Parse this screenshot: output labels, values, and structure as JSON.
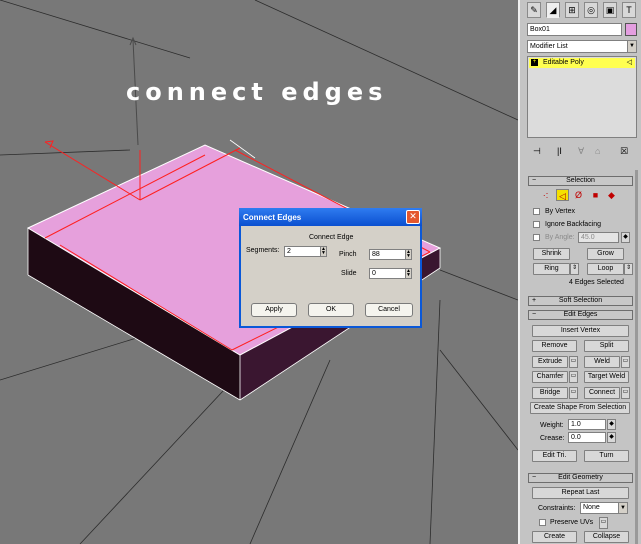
{
  "viewport": {
    "overlay_text": "connect edges"
  },
  "dialog": {
    "title": "Connect Edges",
    "close_glyph": "✕",
    "group_label": "Connect Edge",
    "segments": {
      "label": "Segments:",
      "value": "2"
    },
    "pinch": {
      "label": "Pinch",
      "value": "88"
    },
    "slide": {
      "label": "Slide",
      "value": "0"
    },
    "buttons": {
      "apply": "Apply",
      "ok": "OK",
      "cancel": "Cancel"
    }
  },
  "panel": {
    "tabs": [
      {
        "icon": "create-icon",
        "glyph": "✎"
      },
      {
        "icon": "modify-icon",
        "glyph": "◢"
      },
      {
        "icon": "hierarchy-icon",
        "glyph": "⊞"
      },
      {
        "icon": "motion-icon",
        "glyph": "◎"
      },
      {
        "icon": "display-icon",
        "glyph": "▣"
      },
      {
        "icon": "utilities-icon",
        "glyph": "T"
      }
    ],
    "object_name": "Box01",
    "object_color": "#e49ee0",
    "modifier_list": "Modifier List",
    "stack_item": "Editable Poly",
    "stack_tools": [
      "⊣",
      "|Ι",
      "∀",
      "⌂",
      "☒"
    ],
    "selection": {
      "header": "Selection",
      "collapse_sign": "−",
      "levels": [
        {
          "icon": "vertex-icon",
          "glyph": "·:"
        },
        {
          "icon": "edge-icon",
          "glyph": "◁"
        },
        {
          "icon": "border-icon",
          "glyph": "Ø"
        },
        {
          "icon": "polygon-icon",
          "glyph": "■"
        },
        {
          "icon": "element-icon",
          "glyph": "◆"
        }
      ],
      "by_vertex": "By Vertex",
      "ignore_backfacing": "Ignore Backfacing",
      "by_angle": "By Angle:",
      "angle_value": "45.0",
      "shrink": "Shrink",
      "grow": "Grow",
      "ring": "Ring",
      "loop": "Loop",
      "status": "4 Edges Selected"
    },
    "soft_selection": {
      "header": "Soft Selection",
      "sign": "+"
    },
    "edit_edges": {
      "header": "Edit Edges",
      "sign": "−",
      "insert_vertex": "Insert Vertex",
      "remove": "Remove",
      "split": "Split",
      "extrude": "Extrude",
      "weld": "Weld",
      "chamfer": "Chamfer",
      "target_weld": "Target Weld",
      "bridge": "Bridge",
      "connect": "Connect",
      "create_shape": "Create Shape From Selection",
      "weight_label": "Weight:",
      "weight_value": "1.0",
      "crease_label": "Crease:",
      "crease_value": "0.0",
      "edit_tri": "Edit Tri.",
      "turn": "Turn"
    },
    "edit_geometry": {
      "header": "Edit Geometry",
      "sign": "−",
      "repeat_last": "Repeat Last",
      "constraints_label": "Constraints:",
      "constraints_value": "None",
      "preserve_uvs": "Preserve UVs",
      "create": "Create",
      "collapse": "Collapse"
    }
  }
}
